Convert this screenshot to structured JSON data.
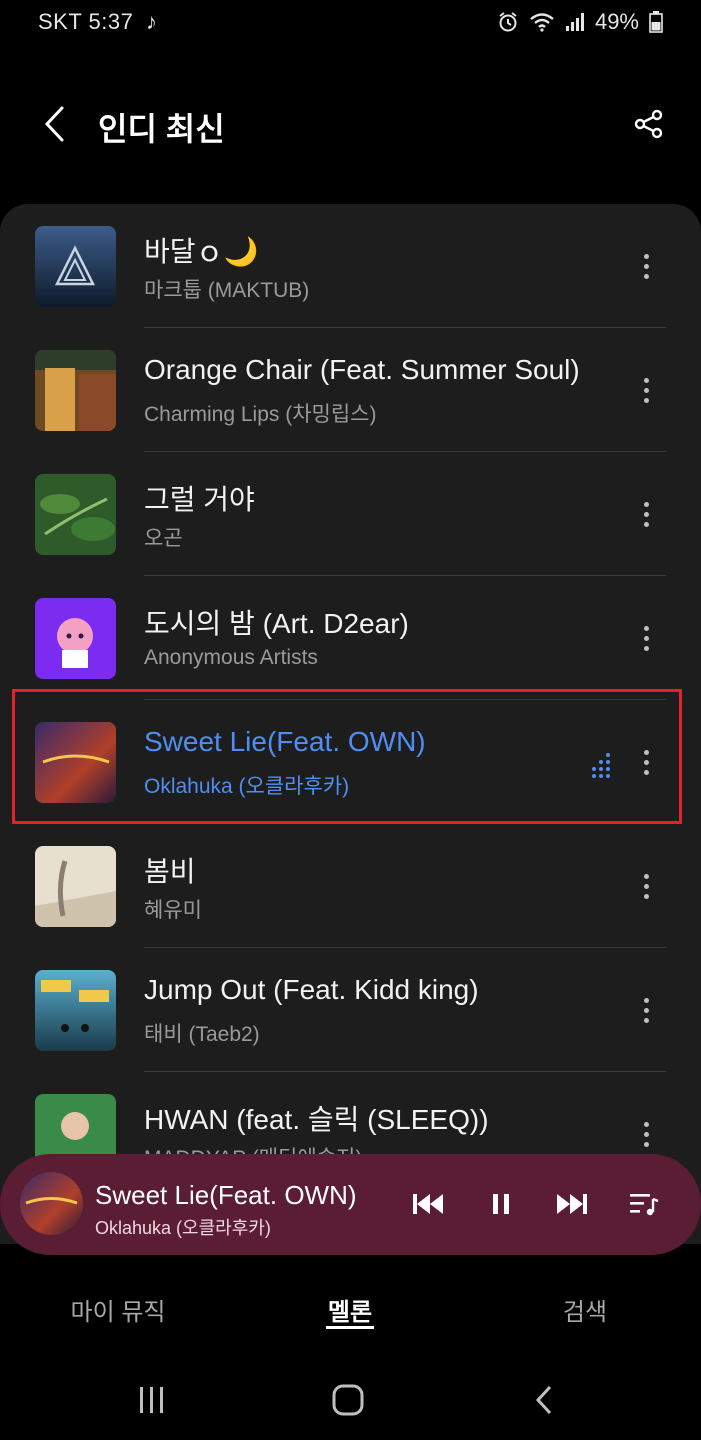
{
  "status_bar": {
    "carrier_time": "SKT 5:37",
    "battery": "49%"
  },
  "header": {
    "title": "인디 최신"
  },
  "songs": [
    {
      "title": "바달ｏ🌙",
      "artist": "마크툽 (MAKTUB)"
    },
    {
      "title": "Orange Chair (Feat. Summer Soul)",
      "artist": "Charming Lips (차밍립스)"
    },
    {
      "title": "그럴 거야",
      "artist": "오곤"
    },
    {
      "title": "도시의 밤 (Art. D2ear)",
      "artist": "Anonymous Artists"
    },
    {
      "title": "Sweet Lie(Feat. OWN)",
      "artist": "Oklahuka (오클라후카)"
    },
    {
      "title": "봄비",
      "artist": "혜유미"
    },
    {
      "title": "Jump Out (Feat. Kidd king)",
      "artist": "태비 (Taeb2)"
    },
    {
      "title": "HWAN (feat. 슬릭 (SLEEQ))",
      "artist": "MADDYAP (매디에솔지)"
    }
  ],
  "now_playing": {
    "title": "Sweet Lie(Feat. OWN)",
    "artist": "Oklahuka (오클라후카)"
  },
  "bottom_nav": {
    "tab_my_music": "마이 뮤직",
    "tab_melon": "멜론",
    "tab_search": "검색"
  },
  "colors": {
    "accent": "#4f8ef2",
    "player_bg": "#5a1d33",
    "highlight": "#e0242a",
    "card_bg": "#1d1d1d"
  }
}
